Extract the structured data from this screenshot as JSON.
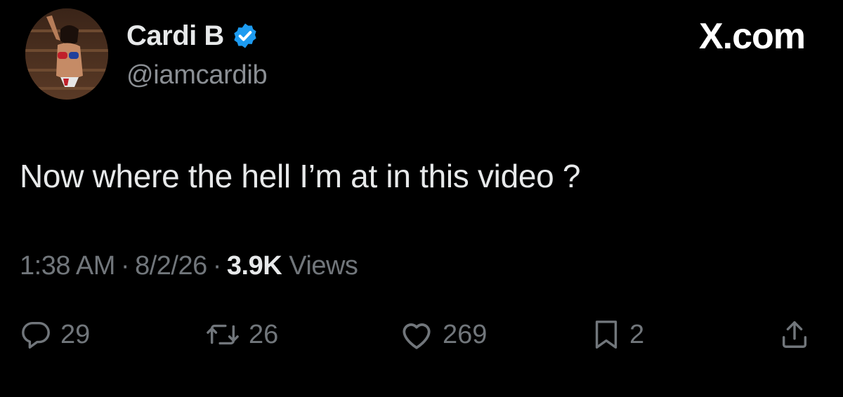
{
  "author": {
    "display_name": "Cardi B",
    "handle": "@iamcardib",
    "verified": true,
    "avatar_icon": "profile-photo"
  },
  "brand": {
    "label": "X.com"
  },
  "tweet": {
    "text": "Now where the hell I’m at in this video ?"
  },
  "meta": {
    "time": "1:38 AM",
    "separator": "·",
    "date": "8/2/26",
    "views_count": "3.9K",
    "views_label": "Views"
  },
  "actions": {
    "reply": {
      "icon": "reply-icon",
      "count": "29"
    },
    "repost": {
      "icon": "repost-icon",
      "count": "26"
    },
    "like": {
      "icon": "heart-icon",
      "count": "269"
    },
    "bookmark": {
      "icon": "bookmark-icon",
      "count": "2"
    },
    "share": {
      "icon": "share-icon"
    }
  },
  "colors": {
    "background": "#000000",
    "primary_text": "#e7e9ea",
    "secondary_text": "#71767b",
    "verified_blue": "#1d9bf0"
  }
}
